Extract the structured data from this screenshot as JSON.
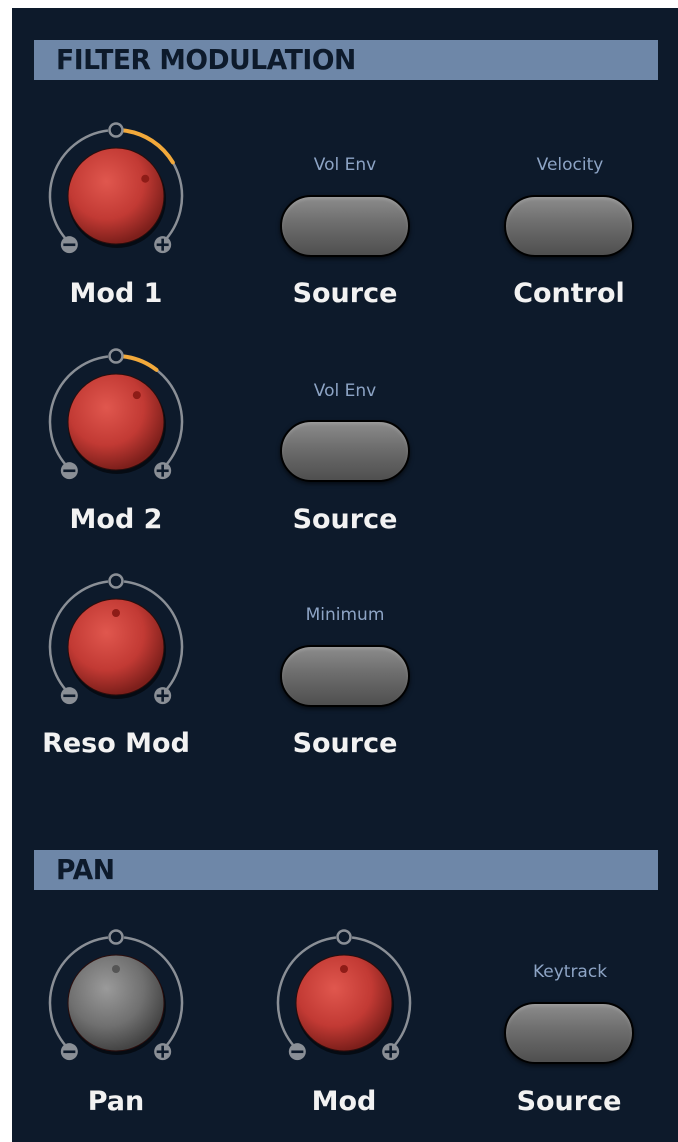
{
  "colors": {
    "panel": "#0d1a2b",
    "header": "#6e87a8",
    "header_text": "#0d1a2b",
    "arc": "#8a8f96",
    "mod_arc": "#f2a93b",
    "knob_red": "#c23a34",
    "knob_gray": "#707070",
    "label": "#f2f2f2",
    "selector_value": "#8da4c5"
  },
  "filter_modulation": {
    "title": "FILTER MODULATION",
    "mod1": {
      "label": "Mod 1",
      "value": 0.44,
      "knob_color": "red"
    },
    "mod1_source": {
      "label": "Source",
      "value": "Vol Env"
    },
    "mod1_control": {
      "label": "Control",
      "value": "Velocity"
    },
    "mod2": {
      "label": "Mod 2",
      "value": 0.28,
      "knob_color": "red"
    },
    "mod2_source": {
      "label": "Source",
      "value": "Vol Env"
    },
    "reso_mod": {
      "label": "Reso Mod",
      "value": 0.0,
      "knob_color": "red"
    },
    "reso_source": {
      "label": "Source",
      "value": "Minimum"
    }
  },
  "pan": {
    "title": "PAN",
    "pan_knob": {
      "label": "Pan",
      "value": 0.0,
      "knob_color": "gray"
    },
    "mod_knob": {
      "label": "Mod",
      "value": 0.0,
      "knob_color": "red"
    },
    "source": {
      "label": "Source",
      "value": "Keytrack"
    }
  },
  "icons": {
    "min": "minus-icon",
    "max": "plus-icon",
    "center": "center-circle-icon"
  }
}
